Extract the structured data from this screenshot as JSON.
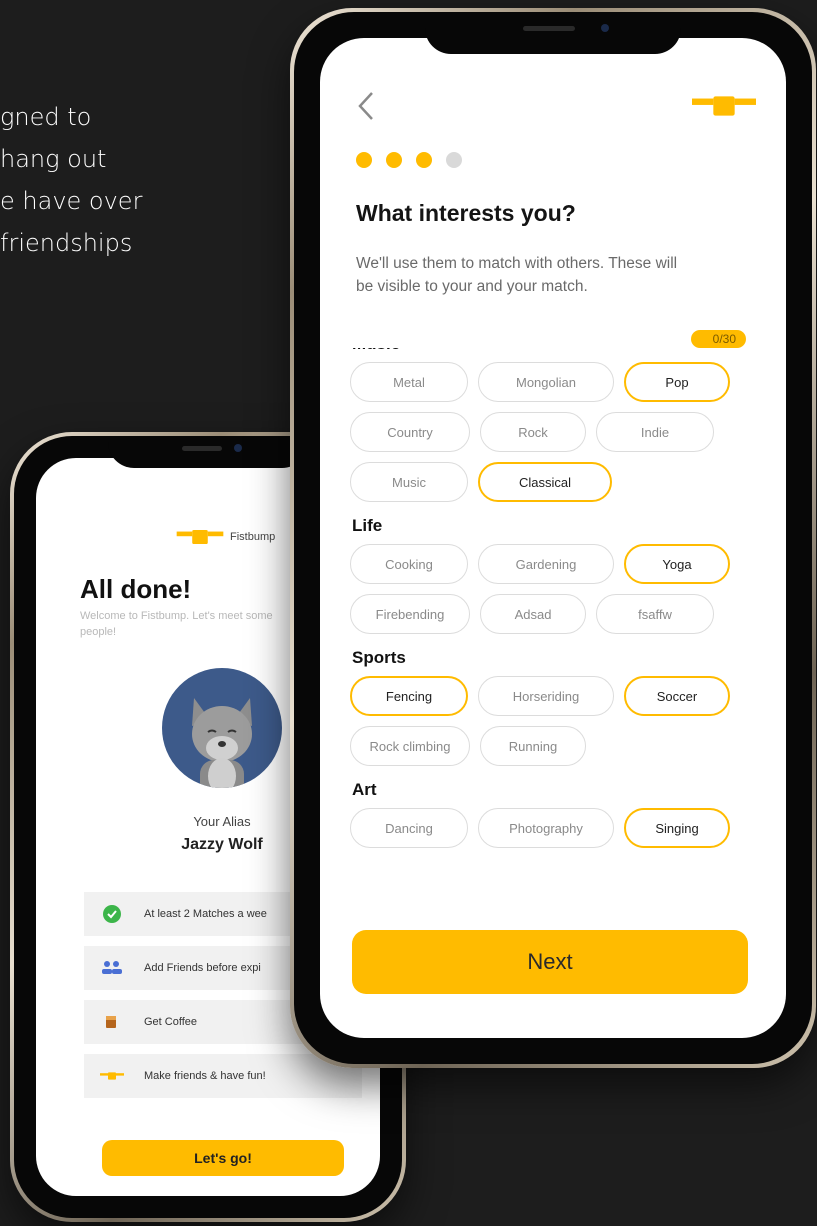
{
  "hero": {
    "lines": [
      "gned to",
      "hang out",
      "e have over",
      "friendships"
    ]
  },
  "colors": {
    "accent": "#ffbb00",
    "chip_border": "#dcdcdc",
    "avatar_bg": "#3d5a8a"
  },
  "onboarding": {
    "step_total": 4,
    "step_current": 3,
    "title": "What interests you?",
    "description": "We'll use them to match with others. These will be visible to your and your match.",
    "counter": "0/30",
    "next_label": "Next",
    "back_icon": "chevron-left-icon",
    "brand_icon": "fistbump-logo-icon",
    "categories": [
      {
        "name": "Music",
        "chips": [
          {
            "label": "Metal",
            "selected": false
          },
          {
            "label": "Mongolian",
            "selected": false
          },
          {
            "label": "Pop",
            "selected": true
          },
          {
            "label": "Country",
            "selected": false
          },
          {
            "label": "Rock",
            "selected": false
          },
          {
            "label": "Indie",
            "selected": false
          },
          {
            "label": "Music",
            "selected": false
          },
          {
            "label": "Classical",
            "selected": true
          }
        ]
      },
      {
        "name": "Life",
        "chips": [
          {
            "label": "Cooking",
            "selected": false
          },
          {
            "label": "Gardening",
            "selected": false
          },
          {
            "label": "Yoga",
            "selected": true
          },
          {
            "label": "Firebending",
            "selected": false
          },
          {
            "label": "Adsad",
            "selected": false
          },
          {
            "label": "fsaffw",
            "selected": false
          }
        ]
      },
      {
        "name": "Sports",
        "chips": [
          {
            "label": "Fencing",
            "selected": true
          },
          {
            "label": "Horseriding",
            "selected": false
          },
          {
            "label": "Soccer",
            "selected": true
          },
          {
            "label": "Rock climbing",
            "selected": false
          },
          {
            "label": "Running",
            "selected": false
          }
        ]
      },
      {
        "name": "Art",
        "chips": [
          {
            "label": "Dancing",
            "selected": false
          },
          {
            "label": "Photography",
            "selected": false
          },
          {
            "label": "Singing",
            "selected": true
          }
        ]
      }
    ]
  },
  "done": {
    "brand_label": "Fistbump",
    "title": "All done!",
    "subtitle": "Welcome to Fistbump. Let's meet some people!",
    "alias_label": "Your Alias",
    "alias_name": "Jazzy Wolf",
    "perks": [
      {
        "icon": "check-circle-icon",
        "label": "At least 2 Matches a wee"
      },
      {
        "icon": "add-friends-icon",
        "label": "Add Friends before expi"
      },
      {
        "icon": "coffee-cup-icon",
        "label": "Get Coffee"
      },
      {
        "icon": "fistbump-logo-icon",
        "label": "Make friends & have fun!"
      }
    ],
    "cta_label": "Let's go!"
  }
}
